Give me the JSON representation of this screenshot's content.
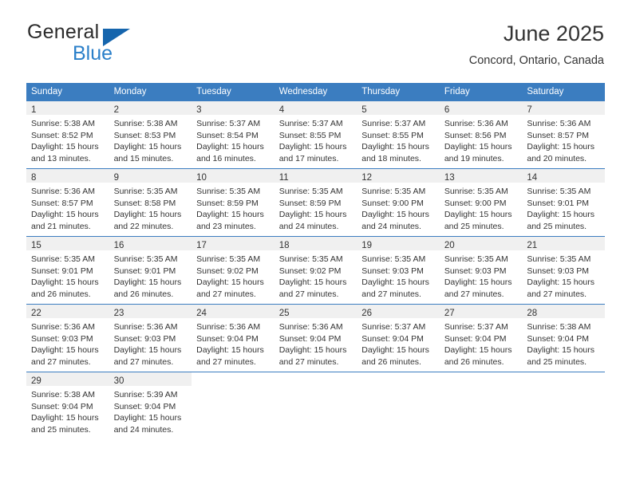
{
  "brand": {
    "name_part1": "General",
    "name_part2": "Blue",
    "triangle_color": "#1565ad",
    "blue_color": "#2a7fc9"
  },
  "header": {
    "title": "June 2025",
    "subtitle": "Concord, Ontario, Canada"
  },
  "theme": {
    "header_bg": "#3b7dc0",
    "daynum_band_bg": "#f0f0f0",
    "grid_line": "#3b7dc0"
  },
  "calendar": {
    "weekday_headers": [
      "Sunday",
      "Monday",
      "Tuesday",
      "Wednesday",
      "Thursday",
      "Friday",
      "Saturday"
    ],
    "weeks": [
      [
        {
          "day": "1",
          "sunrise": "Sunrise: 5:38 AM",
          "sunset": "Sunset: 8:52 PM",
          "daylight1": "Daylight: 15 hours",
          "daylight2": "and 13 minutes."
        },
        {
          "day": "2",
          "sunrise": "Sunrise: 5:38 AM",
          "sunset": "Sunset: 8:53 PM",
          "daylight1": "Daylight: 15 hours",
          "daylight2": "and 15 minutes."
        },
        {
          "day": "3",
          "sunrise": "Sunrise: 5:37 AM",
          "sunset": "Sunset: 8:54 PM",
          "daylight1": "Daylight: 15 hours",
          "daylight2": "and 16 minutes."
        },
        {
          "day": "4",
          "sunrise": "Sunrise: 5:37 AM",
          "sunset": "Sunset: 8:55 PM",
          "daylight1": "Daylight: 15 hours",
          "daylight2": "and 17 minutes."
        },
        {
          "day": "5",
          "sunrise": "Sunrise: 5:37 AM",
          "sunset": "Sunset: 8:55 PM",
          "daylight1": "Daylight: 15 hours",
          "daylight2": "and 18 minutes."
        },
        {
          "day": "6",
          "sunrise": "Sunrise: 5:36 AM",
          "sunset": "Sunset: 8:56 PM",
          "daylight1": "Daylight: 15 hours",
          "daylight2": "and 19 minutes."
        },
        {
          "day": "7",
          "sunrise": "Sunrise: 5:36 AM",
          "sunset": "Sunset: 8:57 PM",
          "daylight1": "Daylight: 15 hours",
          "daylight2": "and 20 minutes."
        }
      ],
      [
        {
          "day": "8",
          "sunrise": "Sunrise: 5:36 AM",
          "sunset": "Sunset: 8:57 PM",
          "daylight1": "Daylight: 15 hours",
          "daylight2": "and 21 minutes."
        },
        {
          "day": "9",
          "sunrise": "Sunrise: 5:35 AM",
          "sunset": "Sunset: 8:58 PM",
          "daylight1": "Daylight: 15 hours",
          "daylight2": "and 22 minutes."
        },
        {
          "day": "10",
          "sunrise": "Sunrise: 5:35 AM",
          "sunset": "Sunset: 8:59 PM",
          "daylight1": "Daylight: 15 hours",
          "daylight2": "and 23 minutes."
        },
        {
          "day": "11",
          "sunrise": "Sunrise: 5:35 AM",
          "sunset": "Sunset: 8:59 PM",
          "daylight1": "Daylight: 15 hours",
          "daylight2": "and 24 minutes."
        },
        {
          "day": "12",
          "sunrise": "Sunrise: 5:35 AM",
          "sunset": "Sunset: 9:00 PM",
          "daylight1": "Daylight: 15 hours",
          "daylight2": "and 24 minutes."
        },
        {
          "day": "13",
          "sunrise": "Sunrise: 5:35 AM",
          "sunset": "Sunset: 9:00 PM",
          "daylight1": "Daylight: 15 hours",
          "daylight2": "and 25 minutes."
        },
        {
          "day": "14",
          "sunrise": "Sunrise: 5:35 AM",
          "sunset": "Sunset: 9:01 PM",
          "daylight1": "Daylight: 15 hours",
          "daylight2": "and 25 minutes."
        }
      ],
      [
        {
          "day": "15",
          "sunrise": "Sunrise: 5:35 AM",
          "sunset": "Sunset: 9:01 PM",
          "daylight1": "Daylight: 15 hours",
          "daylight2": "and 26 minutes."
        },
        {
          "day": "16",
          "sunrise": "Sunrise: 5:35 AM",
          "sunset": "Sunset: 9:01 PM",
          "daylight1": "Daylight: 15 hours",
          "daylight2": "and 26 minutes."
        },
        {
          "day": "17",
          "sunrise": "Sunrise: 5:35 AM",
          "sunset": "Sunset: 9:02 PM",
          "daylight1": "Daylight: 15 hours",
          "daylight2": "and 27 minutes."
        },
        {
          "day": "18",
          "sunrise": "Sunrise: 5:35 AM",
          "sunset": "Sunset: 9:02 PM",
          "daylight1": "Daylight: 15 hours",
          "daylight2": "and 27 minutes."
        },
        {
          "day": "19",
          "sunrise": "Sunrise: 5:35 AM",
          "sunset": "Sunset: 9:03 PM",
          "daylight1": "Daylight: 15 hours",
          "daylight2": "and 27 minutes."
        },
        {
          "day": "20",
          "sunrise": "Sunrise: 5:35 AM",
          "sunset": "Sunset: 9:03 PM",
          "daylight1": "Daylight: 15 hours",
          "daylight2": "and 27 minutes."
        },
        {
          "day": "21",
          "sunrise": "Sunrise: 5:35 AM",
          "sunset": "Sunset: 9:03 PM",
          "daylight1": "Daylight: 15 hours",
          "daylight2": "and 27 minutes."
        }
      ],
      [
        {
          "day": "22",
          "sunrise": "Sunrise: 5:36 AM",
          "sunset": "Sunset: 9:03 PM",
          "daylight1": "Daylight: 15 hours",
          "daylight2": "and 27 minutes."
        },
        {
          "day": "23",
          "sunrise": "Sunrise: 5:36 AM",
          "sunset": "Sunset: 9:03 PM",
          "daylight1": "Daylight: 15 hours",
          "daylight2": "and 27 minutes."
        },
        {
          "day": "24",
          "sunrise": "Sunrise: 5:36 AM",
          "sunset": "Sunset: 9:04 PM",
          "daylight1": "Daylight: 15 hours",
          "daylight2": "and 27 minutes."
        },
        {
          "day": "25",
          "sunrise": "Sunrise: 5:36 AM",
          "sunset": "Sunset: 9:04 PM",
          "daylight1": "Daylight: 15 hours",
          "daylight2": "and 27 minutes."
        },
        {
          "day": "26",
          "sunrise": "Sunrise: 5:37 AM",
          "sunset": "Sunset: 9:04 PM",
          "daylight1": "Daylight: 15 hours",
          "daylight2": "and 26 minutes."
        },
        {
          "day": "27",
          "sunrise": "Sunrise: 5:37 AM",
          "sunset": "Sunset: 9:04 PM",
          "daylight1": "Daylight: 15 hours",
          "daylight2": "and 26 minutes."
        },
        {
          "day": "28",
          "sunrise": "Sunrise: 5:38 AM",
          "sunset": "Sunset: 9:04 PM",
          "daylight1": "Daylight: 15 hours",
          "daylight2": "and 25 minutes."
        }
      ],
      [
        {
          "day": "29",
          "sunrise": "Sunrise: 5:38 AM",
          "sunset": "Sunset: 9:04 PM",
          "daylight1": "Daylight: 15 hours",
          "daylight2": "and 25 minutes."
        },
        {
          "day": "30",
          "sunrise": "Sunrise: 5:39 AM",
          "sunset": "Sunset: 9:04 PM",
          "daylight1": "Daylight: 15 hours",
          "daylight2": "and 24 minutes."
        },
        {
          "day": "",
          "sunrise": "",
          "sunset": "",
          "daylight1": "",
          "daylight2": ""
        },
        {
          "day": "",
          "sunrise": "",
          "sunset": "",
          "daylight1": "",
          "daylight2": ""
        },
        {
          "day": "",
          "sunrise": "",
          "sunset": "",
          "daylight1": "",
          "daylight2": ""
        },
        {
          "day": "",
          "sunrise": "",
          "sunset": "",
          "daylight1": "",
          "daylight2": ""
        },
        {
          "day": "",
          "sunrise": "",
          "sunset": "",
          "daylight1": "",
          "daylight2": ""
        }
      ]
    ]
  }
}
